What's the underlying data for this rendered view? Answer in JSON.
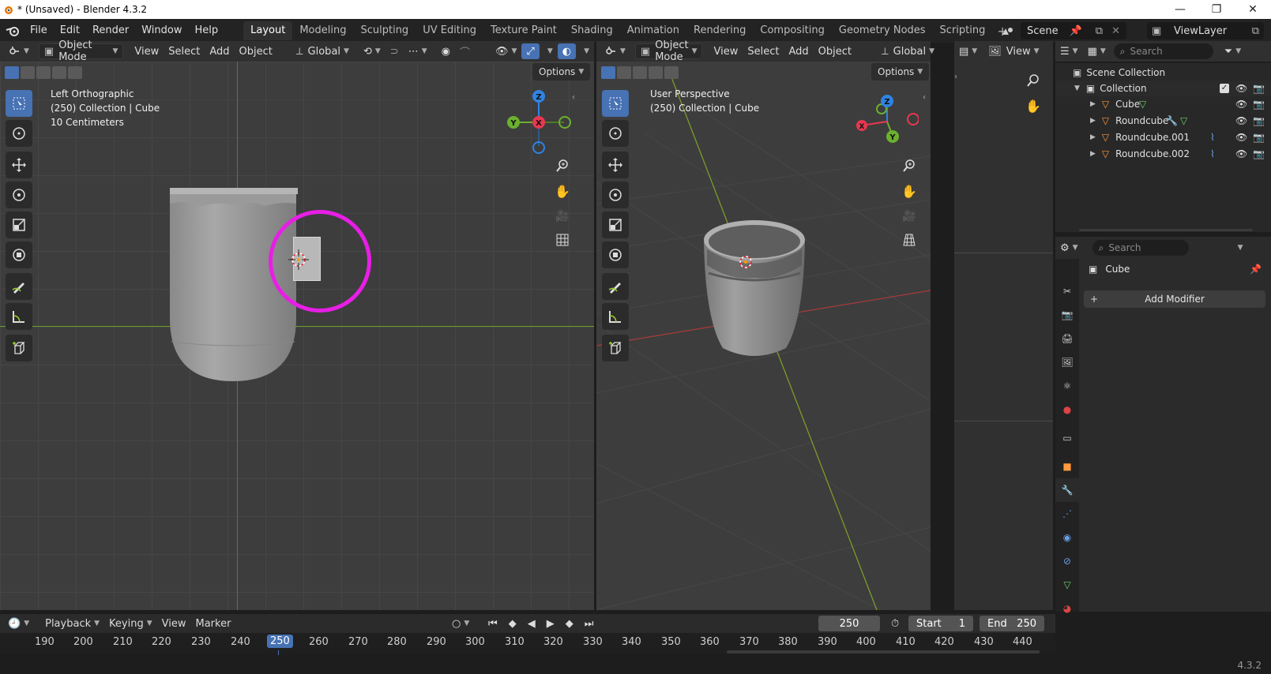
{
  "window": {
    "title": "* (Unsaved) - Blender 4.3.2",
    "minimize": "—",
    "maximize": "❐",
    "close": "✕"
  },
  "menus": [
    "File",
    "Edit",
    "Render",
    "Window",
    "Help"
  ],
  "workspaces": [
    "Layout",
    "Modeling",
    "Sculpting",
    "UV Editing",
    "Texture Paint",
    "Shading",
    "Animation",
    "Rendering",
    "Compositing",
    "Geometry Nodes",
    "Scripting"
  ],
  "active_workspace": "Layout",
  "scene": {
    "name": "Scene",
    "view_layer": "ViewLayer"
  },
  "left_viewport": {
    "mode": "Object Mode",
    "menus": [
      "View",
      "Select",
      "Add",
      "Object"
    ],
    "orientation": "Global",
    "options": "Options",
    "info": {
      "view": "Left Orthographic",
      "collection": "(250) Collection | Cube",
      "scale": "10 Centimeters"
    },
    "gizmo": {
      "z": "Z",
      "y": "Y",
      "x": "X"
    }
  },
  "right_viewport": {
    "mode": "Object Mode",
    "menus": [
      "View",
      "Select",
      "Add",
      "Object"
    ],
    "orientation": "Global",
    "options": "Options",
    "info": {
      "view": "User Perspective",
      "collection": "(250) Collection | Cube"
    },
    "gizmo": {
      "z": "Z",
      "y": "Y",
      "x": "X"
    }
  },
  "image_editor": {
    "view": "View"
  },
  "outliner": {
    "search_placeholder": "Search",
    "root": "Scene Collection",
    "collection": "Collection",
    "items": [
      "Cube",
      "Roundcube",
      "Roundcube.001",
      "Roundcube.002"
    ]
  },
  "properties": {
    "search_placeholder": "Search",
    "object_name": "Cube",
    "add_modifier": "Add Modifier"
  },
  "timeline": {
    "menus": [
      "Playback",
      "Keying",
      "View",
      "Marker"
    ],
    "current_frame": "250",
    "start_label": "Start",
    "start": "1",
    "end_label": "End",
    "end": "250",
    "ticks": [
      "190",
      "200",
      "210",
      "220",
      "230",
      "240",
      "250",
      "260",
      "270",
      "280",
      "290",
      "300",
      "310",
      "320",
      "330",
      "340",
      "350",
      "360",
      "370",
      "380",
      "390",
      "400",
      "410",
      "420",
      "430",
      "440"
    ]
  },
  "version": "4.3.2",
  "colors": {
    "accent": "#4772b3",
    "highlight_circle": "#e81ee6",
    "axis_x": "#e8384f",
    "axis_y": "#6bb02f",
    "axis_z": "#2f83e3"
  }
}
